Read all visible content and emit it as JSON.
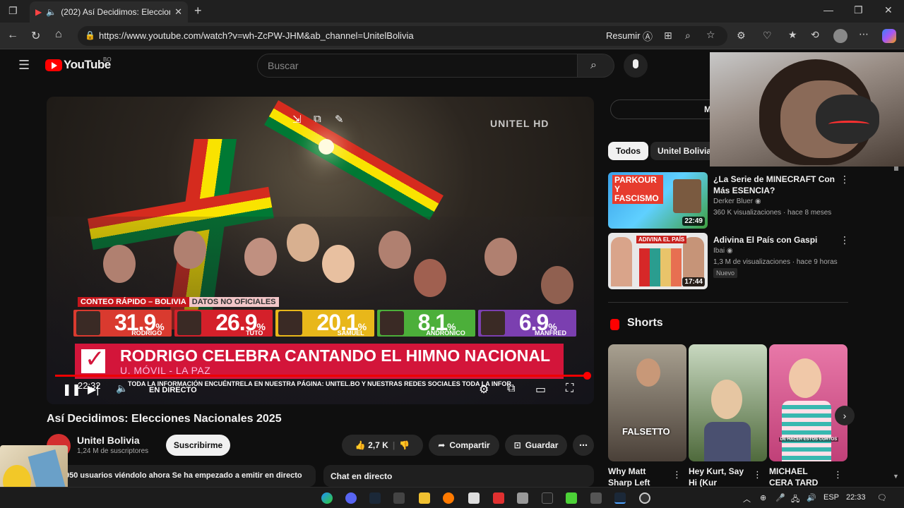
{
  "browser": {
    "tab_title": "(202) Así Decidimos: Elecciones Nacionales 2025",
    "url": "https://www.youtube.com/watch?v=wh-ZcPW-JHM&ab_channel=UnitelBolivia",
    "summarize_label": "Resumir"
  },
  "youtube": {
    "logo_text": "YouTube",
    "logo_badge": "BO",
    "search_placeholder": "Buscar"
  },
  "player": {
    "watermark": "UNITEL HD",
    "banner_tag": "CONTEO RÁPIDO – BOLIVIA",
    "banner_note": "DATOS NO OFICIALES",
    "results": [
      {
        "pct": "31.9",
        "name": "RODRIGO",
        "color": "#d93a2f"
      },
      {
        "pct": "26.9",
        "name": "TUTO",
        "color": "#d4202a"
      },
      {
        "pct": "20.1",
        "name": "SAMUEL",
        "color": "#e8b71a"
      },
      {
        "pct": "8.1",
        "name": "ANDRÓNICO",
        "color": "#4caf3a"
      },
      {
        "pct": "6.9",
        "name": "MANFRED",
        "color": "#7b3fb0"
      }
    ],
    "pct_symbol": "%",
    "headline": "RODRIGO CELEBRA CANTANDO EL HIMNO NACIONAL",
    "subline": "U. MÓVIL - LA PAZ",
    "ticker": "TODA LA INFORMACIÓN ENCUÉNTRELA EN NUESTRA PÁGINA: UNITEL.BO Y NUESTRAS REDES SOCIALES    TODA LA INFOR",
    "time": "22:32",
    "live_label": "EN DIRECTO"
  },
  "video": {
    "title": "Así Decidimos: Elecciones Nacionales 2025",
    "channel": "Unitel Bolivia",
    "subscribers": "1,24 M de suscriptores",
    "subscribe_label": "Suscribirme",
    "likes": "2,7 K",
    "share_label": "Compartir",
    "save_label": "Guardar",
    "viewers_text": "950 usuarios viéndolo ahora  Se ha empezado a emitir en directo",
    "chat_label": "Chat en directo"
  },
  "sidebar": {
    "chat_shell_letter": "M",
    "chips": [
      "Todos",
      "Unitel Bolivia"
    ],
    "recommendations": [
      {
        "title": "¿La Serie de MINECRAFT Con Más ESENCIA?",
        "channel": "Derker Bluer",
        "meta": "360 K visualizaciones · hace 8 meses",
        "duration": "22:49",
        "thumb_text": "PARKOUR Y FASCISMO"
      },
      {
        "title": "Adivina El País con Gaspi",
        "channel": "Ibai",
        "meta": "1,3 M de visualizaciones · hace 9 horas",
        "duration": "17:44",
        "badge": "Nuevo",
        "thumb_text": "ADIVINA EL PAÍS"
      }
    ],
    "shorts_title": "Shorts",
    "shorts": [
      {
        "title": "Why Matt Sharp Left",
        "overlay": "FALSETTO"
      },
      {
        "title": "Hey Kurt, Say Hi (Kur",
        "overlay": ""
      },
      {
        "title": "MICHAEL CERA TARD",
        "overlay": "DE HACER ESTOS CORTOS"
      }
    ]
  },
  "taskbar": {
    "language": "ESP",
    "clock": "22:33"
  },
  "colors": {
    "yt_red": "#ff0000",
    "headline_red": "#d3153a",
    "background": "#0f0f0f"
  }
}
